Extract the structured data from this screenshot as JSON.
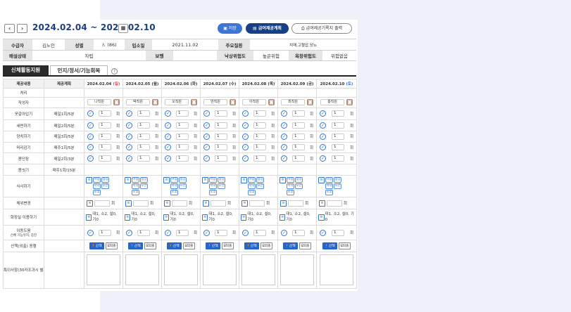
{
  "header": {
    "prev_label": "‹",
    "next_label": "›",
    "date_range": "2024.02.04 ~ 2024.02.10",
    "calendar_icon": "calendar-icon",
    "save_label": "저장",
    "plan_label": "급여제공계획",
    "print_label": "급여제공기록지 출력"
  },
  "recipient": {
    "name_label": "수급자",
    "name": "김노인",
    "gender_label": "성별",
    "grade": "(86)",
    "admit_label": "입소일",
    "admit_date": "2021.11.02",
    "disease_label": "주요질환",
    "disease": "치매,고혈압,당뇨",
    "excretion_label": "배설상태",
    "excretion": "자립",
    "aid_label": "보행",
    "aid": "",
    "fall_label": "낙상위험도",
    "fall": "높은위험",
    "sore_label": "욕창위험도",
    "sore": "위험없음"
  },
  "tabs": [
    {
      "label": "신체활동지원"
    },
    {
      "label": "인지/정서/기능회복"
    }
  ],
  "grid": {
    "col_content": "제공내용",
    "col_plan": "제공계획",
    "dates": [
      {
        "date": "2024.02.04",
        "dow": "(일)",
        "color": "red"
      },
      {
        "date": "2024.02.05",
        "dow": "(월)",
        "color": "none"
      },
      {
        "date": "2024.02.06",
        "dow": "(화)",
        "color": "none"
      },
      {
        "date": "2024.02.07",
        "dow": "(수)",
        "color": "none"
      },
      {
        "date": "2024.02.08",
        "dow": "(목)",
        "color": "none"
      },
      {
        "date": "2024.02.09",
        "dow": "(금)",
        "color": "none"
      },
      {
        "date": "2024.02.10",
        "dow": "(토)",
        "color": "blue"
      }
    ],
    "staff": [
      "나직원",
      "박직원",
      "오직원",
      "반직원",
      "이직원",
      "최직원",
      "홍직원"
    ],
    "unit": "회",
    "rows": [
      {
        "label": "처리",
        "plan": "",
        "type": "empty"
      },
      {
        "label": "작성자",
        "plan": "",
        "type": "staff"
      },
      {
        "label": "옷갈아입기",
        "plan": "매일1회/5분",
        "type": "check",
        "value": "1"
      },
      {
        "label": "세면하기",
        "plan": "매일2회/5분",
        "type": "check",
        "value": "1"
      },
      {
        "label": "양치하기",
        "plan": "매일3회/5분",
        "type": "check",
        "value": "1"
      },
      {
        "label": "머리감기",
        "plan": "매주1회/5분",
        "type": "check",
        "value": "1"
      },
      {
        "label": "몸단장",
        "plan": "매일2회/3분",
        "type": "check",
        "value": "1"
      },
      {
        "label": "몸씻기",
        "plan": "매주1회/15분",
        "type": "empty"
      },
      {
        "label": "식사하기",
        "plan": "",
        "type": "meal",
        "meals": [
          "아침",
          "점심",
          "저녁",
          "오전",
          "오후"
        ]
      },
      {
        "label": "체위변경",
        "plan": "",
        "type": "entry"
      },
      {
        "label": "화장실 이용하기",
        "plan": "",
        "type": "note",
        "text": "대1, 소2, 설0, 기0"
      },
      {
        "label": "이동도움",
        "sublabel": "신체 기능유지, 증진",
        "plan": "",
        "type": "check",
        "value": "1"
      },
      {
        "label": "산책(외출) 동행",
        "plan": "",
        "type": "walk",
        "walk_label": "산책",
        "out_label": "외출"
      },
      {
        "label": "특이사항(30자조과시 별지첨부)",
        "plan": "",
        "type": "notes"
      }
    ]
  }
}
